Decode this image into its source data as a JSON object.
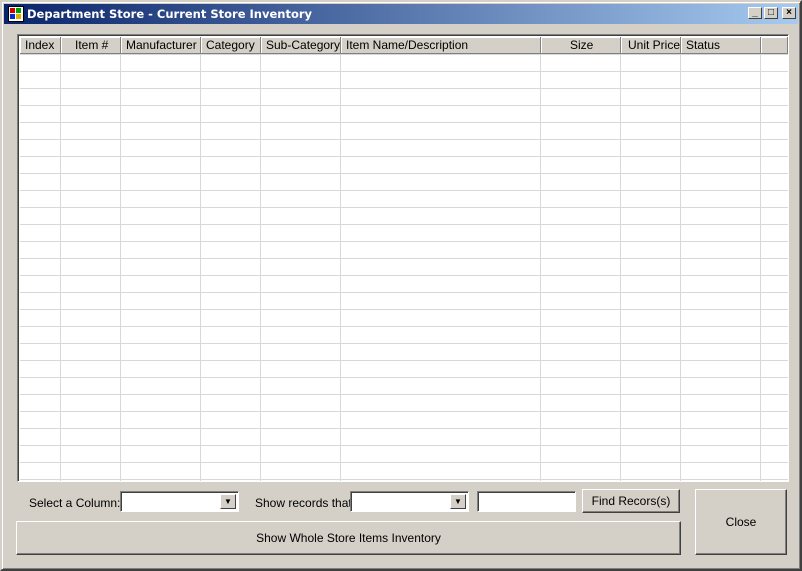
{
  "window": {
    "title": "Department Store - Current Store Inventory",
    "controls": {
      "minimize": "_",
      "maximize": "□",
      "close": "×"
    }
  },
  "grid": {
    "columns": [
      "Index",
      "Item #",
      "Manufacturer",
      "Category",
      "Sub-Category",
      "Item Name/Description",
      "Size",
      "Unit Price",
      "Status"
    ],
    "rows": []
  },
  "filter": {
    "column_label": "Select a Column:",
    "column_value": "",
    "records_label": "Show records that",
    "records_value": "",
    "search_value": "",
    "find_button": "Find Recors(s)"
  },
  "actions": {
    "show_all_button": "Show Whole Store Items Inventory",
    "close_button": "Close"
  },
  "icons": {
    "app": "app-icon",
    "dropdown": "chevron-down-icon"
  },
  "colors": {
    "titlebar_start": "#0a246a",
    "titlebar_end": "#a6caf0",
    "face": "#d4d0c8",
    "gridline": "#d8d8d8"
  }
}
